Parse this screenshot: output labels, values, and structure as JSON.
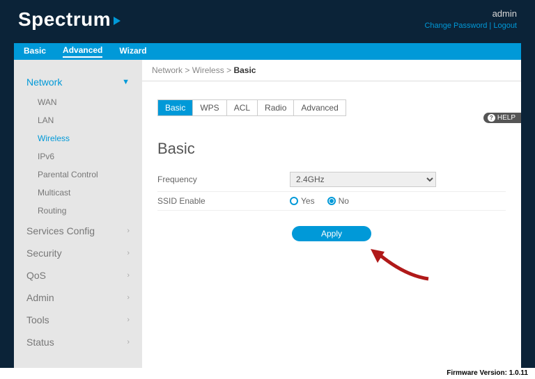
{
  "header": {
    "brand": "Spectrum",
    "user": "admin",
    "change_pw": "Change Password",
    "logout": "Logout"
  },
  "topnav": {
    "items": [
      "Basic",
      "Advanced",
      "Wizard"
    ],
    "active": "Advanced"
  },
  "sidebar": {
    "groups": [
      {
        "label": "Network",
        "open": true,
        "children": [
          {
            "label": "WAN"
          },
          {
            "label": "LAN"
          },
          {
            "label": "Wireless",
            "active": true
          },
          {
            "label": "IPv6"
          },
          {
            "label": "Parental Control"
          },
          {
            "label": "Multicast"
          },
          {
            "label": "Routing"
          }
        ]
      },
      {
        "label": "Services Config"
      },
      {
        "label": "Security"
      },
      {
        "label": "QoS"
      },
      {
        "label": "Admin"
      },
      {
        "label": "Tools"
      },
      {
        "label": "Status"
      }
    ]
  },
  "breadcrumb": {
    "a": "Network",
    "b": "Wireless",
    "c": "Basic",
    "sep": ">"
  },
  "subtabs": {
    "items": [
      "Basic",
      "WPS",
      "ACL",
      "Radio",
      "Advanced"
    ],
    "active": "Basic"
  },
  "section": {
    "title": "Basic",
    "frequency_label": "Frequency",
    "frequency_value": "2.4GHz",
    "ssid_label": "SSID Enable",
    "ssid_yes": "Yes",
    "ssid_no": "No",
    "ssid_value": "No",
    "apply": "Apply"
  },
  "help": {
    "label": "HELP"
  },
  "footer": {
    "fw_label": "Firmware Version:",
    "fw_value": "1.0.11"
  }
}
